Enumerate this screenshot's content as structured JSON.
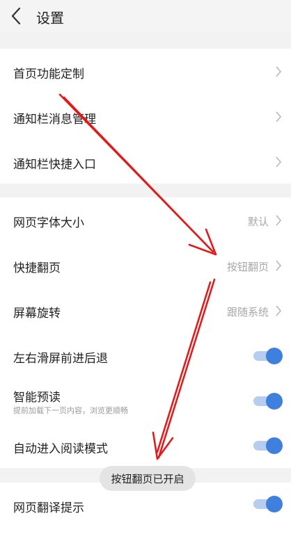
{
  "header": {
    "title": "设置"
  },
  "group1": [
    {
      "label": "首页功能定制"
    },
    {
      "label": "通知栏消息管理"
    },
    {
      "label": "通知栏快捷入口"
    }
  ],
  "group2": [
    {
      "label": "网页字体大小",
      "value": "默认"
    },
    {
      "label": "快捷翻页",
      "value": "按钮翻页"
    },
    {
      "label": "屏幕旋转",
      "value": "跟随系统"
    },
    {
      "label": "左右滑屏前进后退",
      "toggle": true
    },
    {
      "label": "智能预读",
      "sub": "提前加载下一页内容，浏览更顺畅",
      "toggle": true
    },
    {
      "label": "自动进入阅读模式",
      "toggle": true
    }
  ],
  "group3": [
    {
      "label": "网页翻译提示",
      "toggle": true
    }
  ],
  "toast": "按钮翻页已开启",
  "colors": {
    "accent": "#3f7fdd",
    "annotation": "#e21a1a"
  }
}
